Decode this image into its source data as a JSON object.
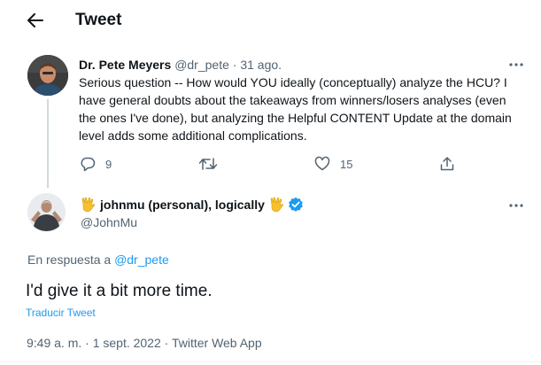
{
  "header": {
    "title": "Tweet",
    "back_icon": "arrow-left-icon"
  },
  "parent_tweet": {
    "author_name": "Dr. Pete Meyers",
    "handle": "@dr_pete",
    "separator": "·",
    "date": "31 ago.",
    "text": "Serious question -- How would YOU ideally (conceptually) analyze the HCU? I have general doubts about the takeaways from winners/losers analyses (even the ones I've done), but analyzing the Helpful CONTENT Update at the domain level adds some additional complications.",
    "replies": "9",
    "likes": "15"
  },
  "main_tweet": {
    "author_name": "johnmu (personal), logically",
    "name_emoji": "vulcan-salute-icon",
    "verified_color": "#1d9bf0",
    "handle": "@JohnMu",
    "reply_prefix": "En respuesta a",
    "reply_to": "@dr_pete",
    "text": "I'd give it a bit more time.",
    "translate_label": "Traducir Tweet",
    "meta": "9:49 a. m. · 1 sept. 2022 · Twitter Web App"
  },
  "colors": {
    "accent": "#1d9bf0",
    "text": "#0f1419",
    "muted": "#536471",
    "thread_line": "#cfd9de"
  }
}
